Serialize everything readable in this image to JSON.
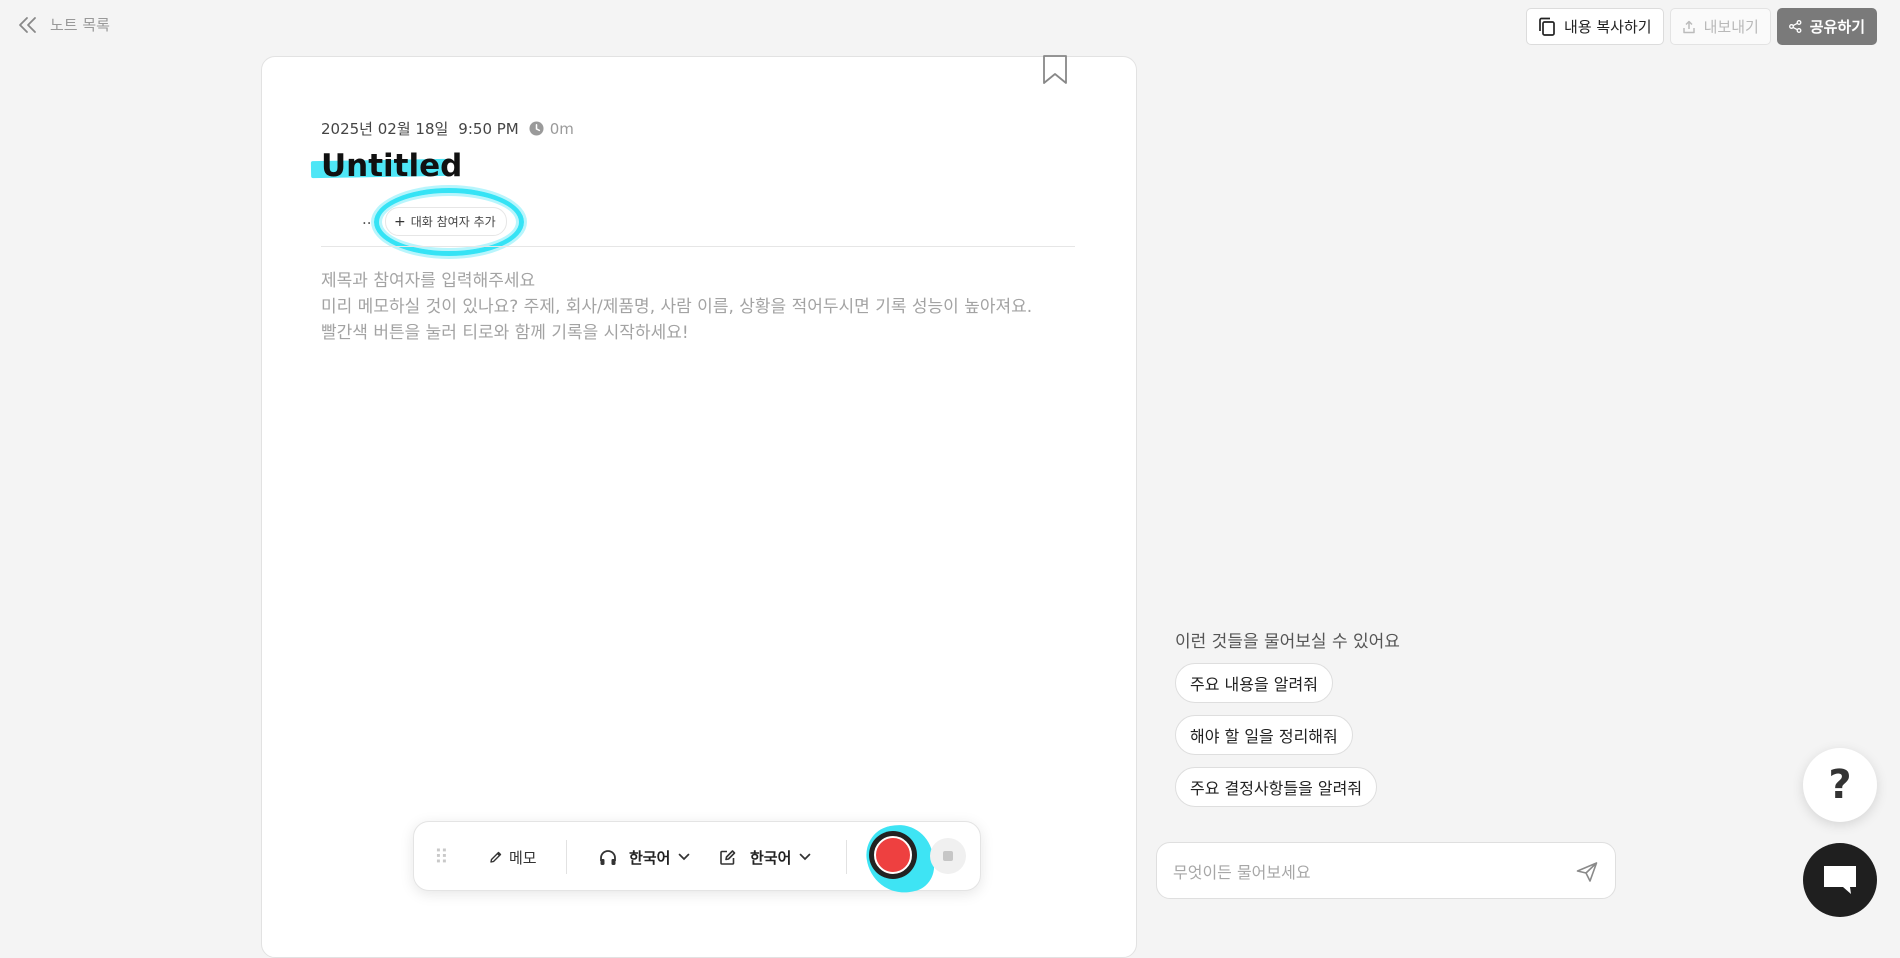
{
  "header": {
    "back_label": "노트 목록",
    "actions": {
      "copy_label": "내용 복사하기",
      "export_label": "내보내기",
      "share_label": "공유하기"
    }
  },
  "note": {
    "date": "2025년 02월 18일",
    "time": "9:50 PM",
    "duration": "0m",
    "title": "Untitled",
    "participants_dots": "..",
    "add_participant_label": "대화 참여자 추가",
    "placeholder_lines": [
      "제목과 참여자를 입력해주세요",
      "미리 메모하실 것이 있나요? 주제, 회사/제품명, 사람 이름, 상황을 적어두시면 기록 성능이 높아져요.",
      "빨간색 버튼을 눌러 티로와 함께 기록을 시작하세요!"
    ]
  },
  "toolbar": {
    "memo_label": "메모",
    "audio_language": "한국어",
    "note_language": "한국어",
    "icons": [
      "drag-grip-icon",
      "pencil-icon",
      "headphones-icon",
      "edit-icon",
      "chevron-down-icon",
      "record-icon",
      "stop-icon"
    ]
  },
  "assistant": {
    "suggest_title": "이런 것들을 물어보실 수 있어요",
    "suggestions": [
      "주요 내용을 알려줘",
      "해야 할 일을 정리해줘",
      "주요 결정사항들을 알려줘"
    ],
    "input_placeholder": "무엇이든 물어보세요",
    "help_symbol": "?"
  },
  "colors": {
    "record": "#ee4040",
    "highlight": "#3ee4f4",
    "share_button": "#7a7a7a"
  }
}
